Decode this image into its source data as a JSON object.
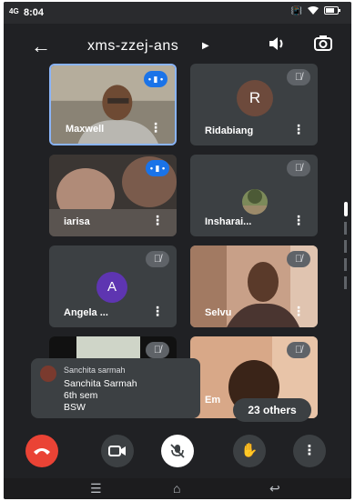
{
  "status_bar": {
    "signal": "4G",
    "time": "8:04",
    "icons": [
      "vibrate-icon",
      "wifi-icon",
      "battery-icon"
    ]
  },
  "header": {
    "meeting_code": "xms-zzej-ans",
    "icons": [
      "back-arrow-icon",
      "caret-right-icon",
      "speaker-icon",
      "camera-flip-icon"
    ]
  },
  "participants": [
    {
      "name": "Maxwell",
      "state": "speaking",
      "view": "video"
    },
    {
      "name": "Ridabiang",
      "state": "muted",
      "view": "avatar",
      "initial": "R",
      "avatar_color": "#6d4a3c"
    },
    {
      "name": "iarisa",
      "state": "speaking",
      "view": "video"
    },
    {
      "name": "Insharai...",
      "state": "muted",
      "view": "photo"
    },
    {
      "name": "Angela ...",
      "state": "muted",
      "view": "avatar",
      "initial": "A",
      "avatar_color": "#5e35b1"
    },
    {
      "name": "Selvu",
      "state": "muted",
      "view": "video"
    },
    {
      "name": "",
      "state": "muted",
      "view": "video"
    },
    {
      "name": "Em",
      "state": "muted",
      "view": "video"
    }
  ],
  "chat_toast": {
    "sender": "Sanchita sarmah",
    "message": "Sanchita Sarmah\n6th sem\nBSW"
  },
  "others_badge": "23 others",
  "controls": [
    {
      "name": "end-call-button",
      "icon": "phone-hangup-icon",
      "color": "#ea4335"
    },
    {
      "name": "camera-button",
      "icon": "video-camera-icon",
      "color": "#3c4043"
    },
    {
      "name": "mic-button",
      "icon": "mic-off-icon",
      "color": "#ffffff"
    },
    {
      "name": "raise-hand-button",
      "icon": "hand-icon",
      "color": "#3c4043"
    },
    {
      "name": "more-options-button",
      "icon": "more-vert-icon",
      "color": "#3c4043"
    }
  ],
  "accent_colors": {
    "speaking": "#1a73e8",
    "selected_border": "#8ab4f8",
    "end_call": "#ea4335"
  }
}
